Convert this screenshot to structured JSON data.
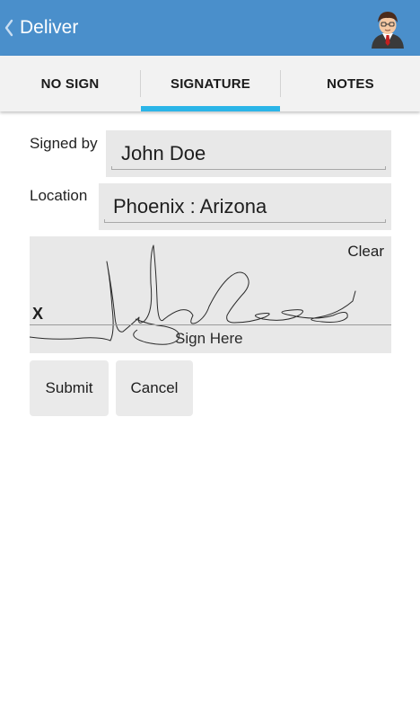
{
  "appbar": {
    "title": "Deliver",
    "back_icon": "chevron-left-icon",
    "avatar_icon": "user-avatar-icon",
    "background_color": "#4a8fcb"
  },
  "tabs": [
    {
      "label": "NO SIGN",
      "selected": false
    },
    {
      "label": "SIGNATURE",
      "selected": true
    },
    {
      "label": "NOTES",
      "selected": false
    }
  ],
  "accent_color": "#2bb5e8",
  "form": {
    "signed_by_label": "Signed by",
    "signed_by_value": "John Doe",
    "location_label": "Location",
    "location_value": "Phoenix : Arizona"
  },
  "signature_pad": {
    "clear_label": "Clear",
    "x_mark": "X",
    "hint": "Sign Here",
    "has_signature": true
  },
  "actions": {
    "submit_label": "Submit",
    "cancel_label": "Cancel"
  }
}
